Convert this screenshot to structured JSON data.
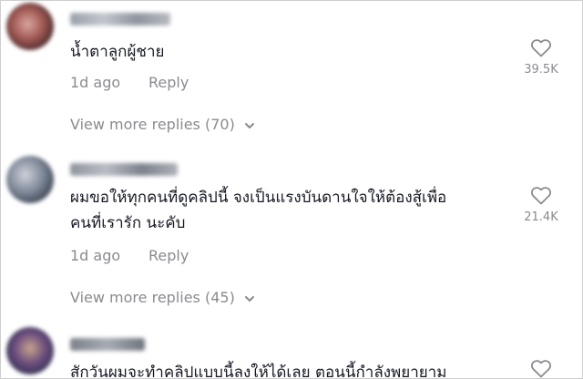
{
  "comments": [
    {
      "text_lines": [
        "น้ำตาลูกผู้ชาย"
      ],
      "time": "1d ago",
      "reply_label": "Reply",
      "likes": "39.5K",
      "view_more": "View more replies (70)"
    },
    {
      "text_lines": [
        "ผมขอให้ทุกคนที่ดูคลิปนี้ จงเป็นแรงบันดานใจให้ต้องสู้เพื่อ",
        "คนที่เรารัก นะคับ"
      ],
      "time": "1d ago",
      "reply_label": "Reply",
      "likes": "21.4K",
      "view_more": "View more replies (45)"
    },
    {
      "text_lines": [
        "สักวันผมจะทำคลิปแบบนี้ลงให้ได้เลย ตอนนี้กำลังพยายาม"
      ]
    }
  ],
  "icons": {
    "like": "heart-outline-icon",
    "expand": "chevron-down-icon"
  },
  "colors": {
    "text": "#161823",
    "muted": "#8a8b91"
  }
}
